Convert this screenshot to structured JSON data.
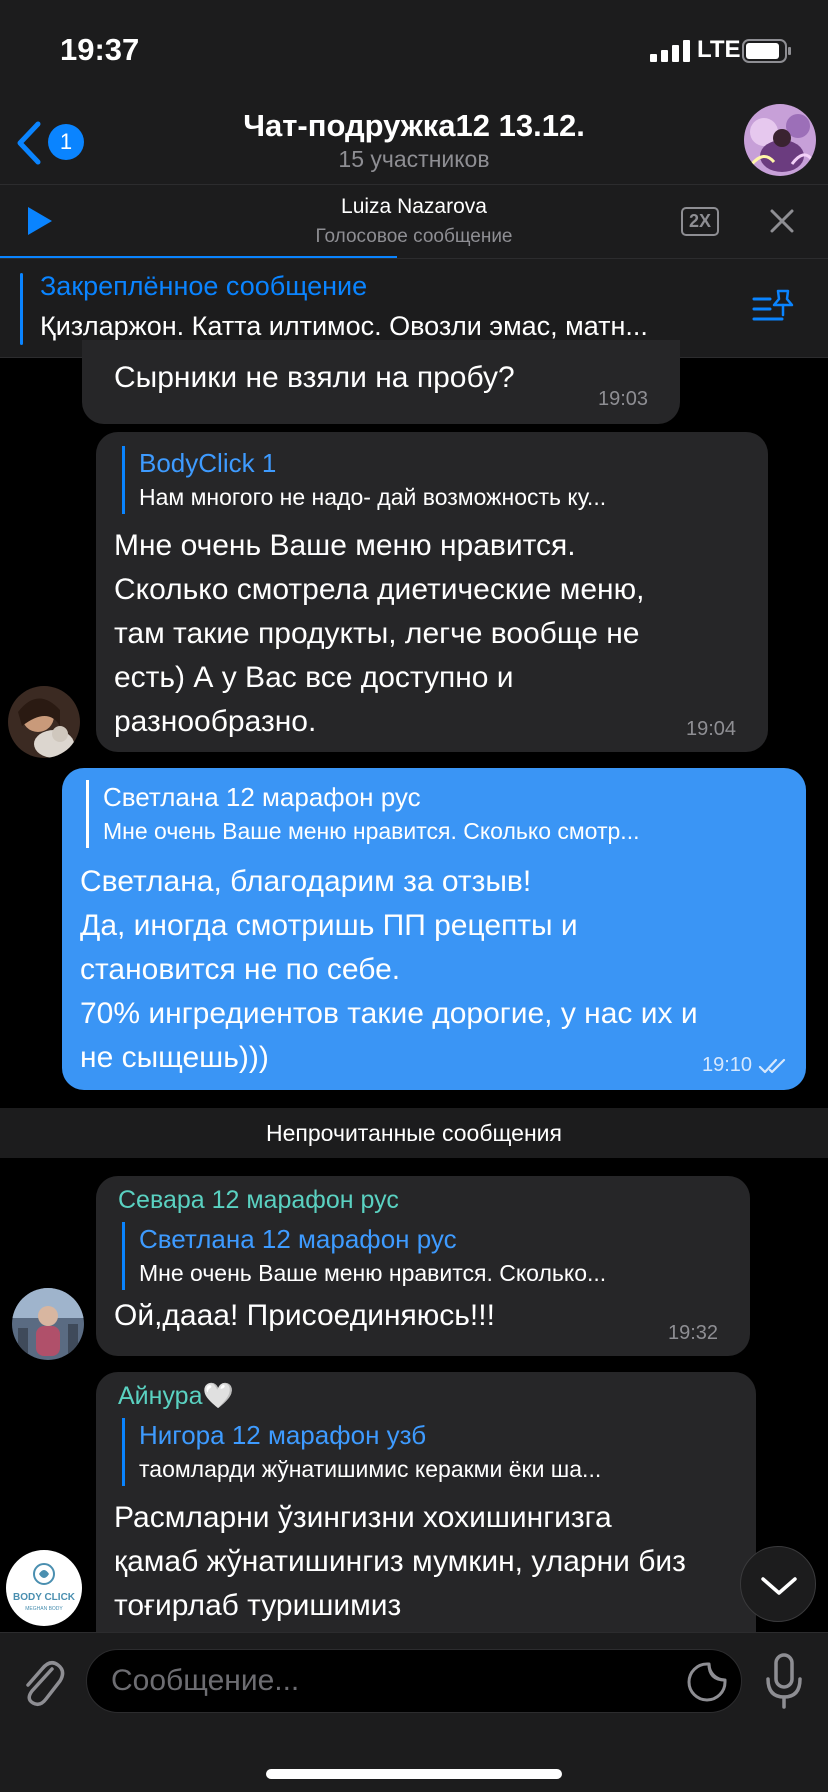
{
  "status": {
    "time": "19:37",
    "network": "LTE"
  },
  "header": {
    "back_badge": "1",
    "title": "Чат-подружка12 13.12.",
    "subtitle": "15 участников"
  },
  "audio": {
    "name": "Luiza Nazarova",
    "kind": "Голосовое сообщение",
    "speed": "2X",
    "progress": 0.48
  },
  "pinned": {
    "title": "Закреплённое сообщение",
    "text": "Қизларжон. Катта илтимос. Овозли эмас, матн..."
  },
  "messages": [
    {
      "text": "Сырники не взяли на пробу?",
      "time": "19:03"
    },
    {
      "reply_name": "BodyClick 1",
      "reply_text": "Нам многого не надо- дай возможность ку...",
      "text": "Мне очень Ваше меню нравится. Сколько смотрела диетические меню, там такие продукты, легче вообще не есть) А у Вас все доступно и разнообразно.",
      "time": "19:04"
    },
    {
      "reply_name": "Светлана 12 марафон рус",
      "reply_text": "Мне очень Ваше меню нравится. Сколько смотр...",
      "text": "Светлана, благодарим за отзыв!\nДа, иногда смотришь ПП рецепты и становится не по себе.\n70% ингредиентов такие дорогие, у нас их и не сыщешь)))",
      "time": "19:10"
    },
    {
      "sender": "Севара 12 марафон рус",
      "reply_name": "Светлана 12 марафон рус",
      "reply_text": "Мне очень Ваше меню нравится. Сколько...",
      "text": "Ой,дааа! Присоединяюсь!!!",
      "time": "19:32"
    },
    {
      "sender": "Айнура🤍",
      "reply_name": "Нигора 12 марафон узб",
      "reply_text": "таомларди жўнатишимис керакми ёки ша...",
      "text": "Расмларни ўзингизни хохишингизга қамаб жўнатишингиз мумкин, уларни биз тоғирлаб туришимиз"
    }
  ],
  "unread_label": "Непрочитанные сообщения",
  "bodyclick_logo": {
    "line1": "BODY CLICK",
    "line2": "MEGHAN BODY"
  },
  "input": {
    "placeholder": "Сообщение..."
  },
  "colors": {
    "accent": "#0a84ff",
    "outgoing": "#3a95f5",
    "incoming": "#262628",
    "sender_teal": "#5ad1c1"
  }
}
